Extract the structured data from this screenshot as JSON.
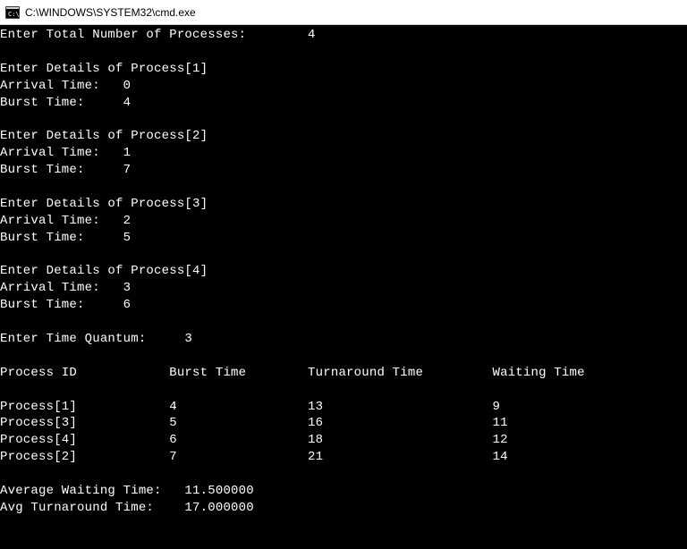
{
  "titlebar": {
    "title": "C:\\WINDOWS\\SYSTEM32\\cmd.exe"
  },
  "prompts": {
    "total_processes": "Enter Total Number of Processes:",
    "total_processes_val": "4",
    "details_prefix": "Enter Details of Process",
    "arrival_label": "Arrival Time:",
    "burst_label": "Burst Time:",
    "time_quantum_label": "Enter Time Quantum:",
    "time_quantum_val": "3"
  },
  "processes": [
    {
      "n": "1",
      "arrival": "0",
      "burst": "4"
    },
    {
      "n": "2",
      "arrival": "1",
      "burst": "7"
    },
    {
      "n": "3",
      "arrival": "2",
      "burst": "5"
    },
    {
      "n": "4",
      "arrival": "3",
      "burst": "6"
    }
  ],
  "chart_data": {
    "type": "table",
    "headers": [
      "Process ID",
      "Burst Time",
      "Turnaround Time",
      "Waiting Time"
    ],
    "rows": [
      {
        "pid": "Process[1]",
        "burst": "4",
        "turnaround": "13",
        "waiting": "9"
      },
      {
        "pid": "Process[3]",
        "burst": "5",
        "turnaround": "16",
        "waiting": "11"
      },
      {
        "pid": "Process[4]",
        "burst": "6",
        "turnaround": "18",
        "waiting": "12"
      },
      {
        "pid": "Process[2]",
        "burst": "7",
        "turnaround": "21",
        "waiting": "14"
      }
    ]
  },
  "summary": {
    "avg_waiting_label": "Average Waiting Time:",
    "avg_waiting_val": "11.500000",
    "avg_turnaround_label": "Avg Turnaround Time:",
    "avg_turnaround_val": "17.000000"
  }
}
